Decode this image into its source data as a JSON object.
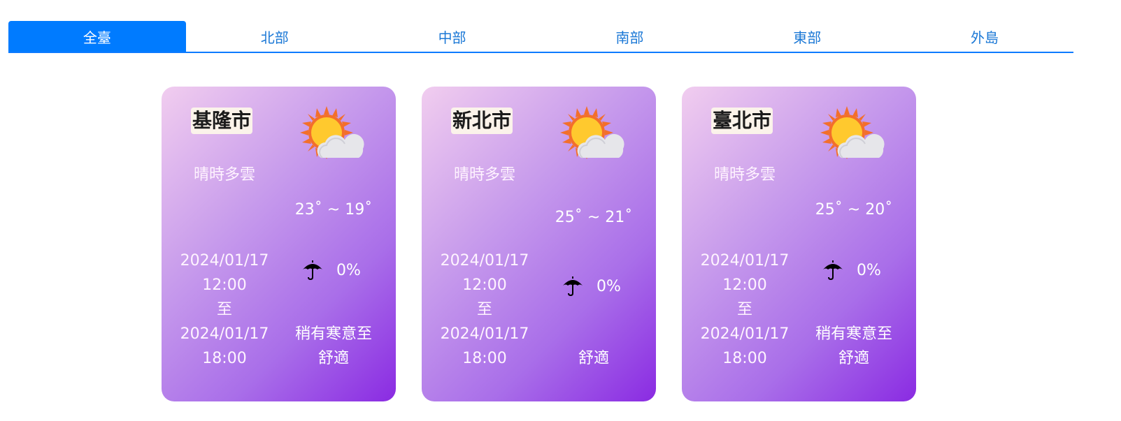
{
  "tabs": [
    {
      "label": "全臺",
      "active": true
    },
    {
      "label": "北部",
      "active": false
    },
    {
      "label": "中部",
      "active": false
    },
    {
      "label": "南部",
      "active": false
    },
    {
      "label": "東部",
      "active": false
    },
    {
      "label": "外島",
      "active": false
    }
  ],
  "cards": [
    {
      "city": "基隆市",
      "desc": "晴時多雲",
      "weather_icon": "sun-cloud-icon",
      "temp": "23˚ ~ 19˚",
      "time_start_date": "2024/01/17",
      "time_start_clock": "12:00",
      "time_sep": "至",
      "time_end_date": "2024/01/17",
      "time_end_clock": "18:00",
      "rain": "0%",
      "feel_1": "稍有寒意至",
      "feel_2": "舒適"
    },
    {
      "city": "新北市",
      "desc": "晴時多雲",
      "weather_icon": "sun-cloud-icon",
      "temp": "25˚ ~ 21˚",
      "time_start_date": "2024/01/17",
      "time_start_clock": "12:00",
      "time_sep": "至",
      "time_end_date": "2024/01/17",
      "time_end_clock": "18:00",
      "rain": "0%",
      "feel_1": "",
      "feel_2": "舒適"
    },
    {
      "city": "臺北市",
      "desc": "晴時多雲",
      "weather_icon": "sun-cloud-icon",
      "temp": "25˚ ~ 20˚",
      "time_start_date": "2024/01/17",
      "time_start_clock": "12:00",
      "time_sep": "至",
      "time_end_date": "2024/01/17",
      "time_end_clock": "18:00",
      "rain": "0%",
      "feel_1": "稍有寒意至",
      "feel_2": "舒適"
    }
  ],
  "colors": {
    "tab_active": "#007bff",
    "tab_text": "#1b78d6",
    "card_gradient_end": "#8a2be2"
  }
}
